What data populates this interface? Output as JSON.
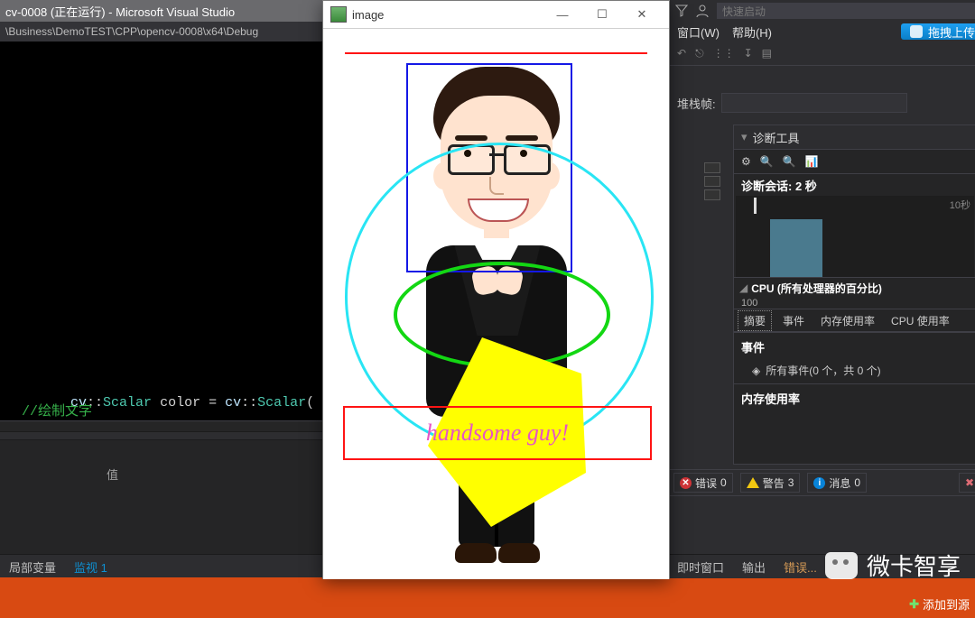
{
  "titlebar": {
    "text": "cv-0008 (正在运行) - Microsoft Visual Studio"
  },
  "pathbar": {
    "text": "\\Business\\DemoTEST\\CPP\\opencv-0008\\x64\\Debug"
  },
  "code": {
    "line1_ns1": "cv",
    "line1_sep1": "::",
    "line1_type1": "Scalar",
    "line1_mid": " color = ",
    "line1_ns2": "cv",
    "line1_sep2": "::",
    "line1_type2": "Scalar",
    "line1_tail": "(",
    "line2": "//绘制文字"
  },
  "watch": {
    "header_value": "值",
    "tab_locals": "局部变量",
    "tab_watch1": "监视 1",
    "tab_errtab": "错误..."
  },
  "rtop": {
    "quicklaunch_placeholder": "快速启动"
  },
  "rmenu": {
    "window": "窗口(W)",
    "help": "帮助(H)",
    "drag_upload": "拖拽上传"
  },
  "frow": {
    "label": "堆栈帧:"
  },
  "diag": {
    "title": "诊断工具",
    "session": "诊断会话: 2 秒",
    "tick": "10秒",
    "cpu_label": "CPU (所有处理器的百分比)",
    "cpu_val": "100",
    "tab_summary": "摘要",
    "tab_events": "事件",
    "tab_mem": "内存使用率",
    "tab_cpu": "CPU 使用率",
    "sec_events": "事件",
    "events_row": "所有事件(0 个，共 0 个)",
    "sec_mem": "内存使用率"
  },
  "errlist": {
    "errors_label": "错误",
    "errors_count": "0",
    "warn_label": "警告",
    "warn_count": "3",
    "info_label": "消息",
    "info_count": "0"
  },
  "brtabs": {
    "immediate": "即时窗口",
    "output": "输出",
    "err": "错误..."
  },
  "brand": {
    "text": "微卡智享"
  },
  "addsrc": {
    "text": "添加到源"
  },
  "imgwin": {
    "title": "image",
    "overlay_text": "handsome guy!"
  }
}
